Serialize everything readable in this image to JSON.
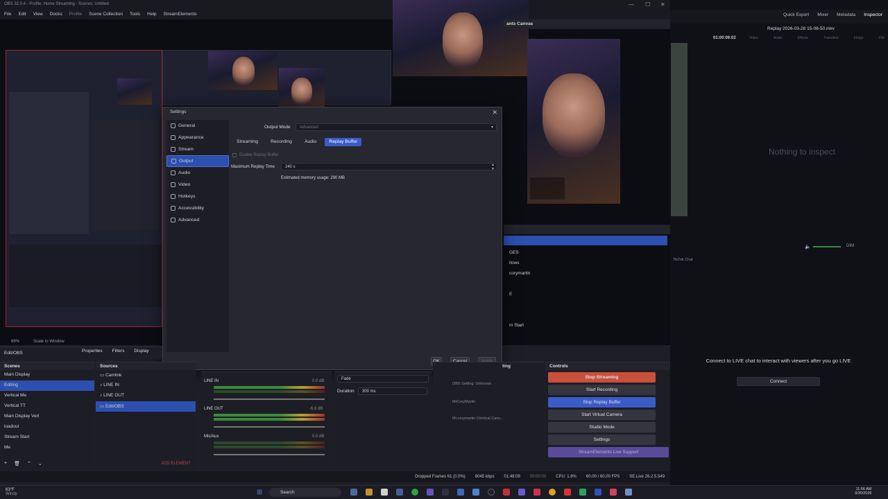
{
  "window": {
    "title": "OBS 32.0.4 - Profile: Home Streaming - Scenes: Untitled",
    "menu": [
      "File",
      "Edit",
      "View",
      "Docks",
      "Profile",
      "Scene Collection",
      "Tools",
      "Help",
      "StreamElements"
    ]
  },
  "preview": {
    "zoom_label": "69%",
    "scale_label": "Scale to Window",
    "canvas_label": "ants Canvas",
    "sources_list": [
      "GES",
      "llows",
      "corymartin",
      "E",
      "m Start"
    ]
  },
  "right_panel": {
    "toolbar": [
      "Quick Export",
      "Mixer",
      "Metadata",
      "Inspector"
    ],
    "file_name": "Replay 2026-03-28 15-08-50.mkv",
    "timecode": "01:00:06:02",
    "inspector_tabs": [
      "Video",
      "Audio",
      "Effects",
      "Transition",
      "Image",
      "File"
    ],
    "empty_text": "Nothing to inspect",
    "volume_label": "DIM",
    "chat_title": "TikTok Chat",
    "chat_message": "Connect to LIVE chat to interact with viewers after you go LIVE",
    "connect_label": "Connect"
  },
  "settings": {
    "title": "Settings",
    "sidebar": [
      {
        "label": "General",
        "icon": "gear-icon"
      },
      {
        "label": "Appearance",
        "icon": "palette-icon"
      },
      {
        "label": "Stream",
        "icon": "stream-icon"
      },
      {
        "label": "Output",
        "icon": "output-icon"
      },
      {
        "label": "Audio",
        "icon": "speaker-icon"
      },
      {
        "label": "Video",
        "icon": "monitor-icon"
      },
      {
        "label": "Hotkeys",
        "icon": "keyboard-icon"
      },
      {
        "label": "Accessibility",
        "icon": "accessibility-icon"
      },
      {
        "label": "Advanced",
        "icon": "wrench-icon"
      }
    ],
    "output_mode_label": "Output Mode",
    "output_mode_value": "Advanced",
    "tabs": [
      "Streaming",
      "Recording",
      "Audio",
      "Replay Buffer"
    ],
    "enable_replay_label": "Enable Replay Buffer",
    "max_replay_label": "Maximum Replay Time",
    "max_replay_value": "240 s",
    "memory_usage": "Estimated memory usage: 290 MB",
    "ok": "OK",
    "cancel": "Cancel",
    "apply": "Apply"
  },
  "docks": {
    "editobs_label": "Edit/OBS",
    "properties": "Properties",
    "filters": "Filters",
    "display": "Display",
    "scenes_title": "Scenes",
    "scenes": [
      "Main Display",
      "Editing",
      "Vertical Me",
      "Vertical TT",
      "Main Display Vert",
      "loadout",
      "Stream Start",
      "Me"
    ],
    "sources_title": "Sources",
    "sources": [
      "Camlink",
      "LINE IN",
      "LINE OUT",
      "Edit/OBS"
    ],
    "add_element": "ADD ELEMENT",
    "mixer": [
      {
        "name": "LINE IN",
        "db": "0.0 dB"
      },
      {
        "name": "LINE OUT",
        "db": "-6.6 dB"
      },
      {
        "name": "Mic/Aux",
        "db": "0.0 dB"
      }
    ],
    "transition": "Fade",
    "duration_label": "Duration",
    "duration_value": "300 ms",
    "ting_label": "ting",
    "ting_items": [
      "OBS Setting: Unknown",
      "MrCoryMartin",
      "Mr.corymartin (Vertical Canv..."
    ],
    "controls_title": "Controls",
    "controls": {
      "stop_streaming": "Stop Streaming",
      "start_recording": "Start Recording",
      "stop_replay": "Stop Replay Buffer",
      "start_virtual_cam": "Start Virtual Camera",
      "studio_mode": "Studio Mode",
      "settings": "Settings",
      "live_support": "StreamElements Live Support"
    }
  },
  "status": {
    "dropped": "Dropped Frames 61 (0.0%)",
    "bitrate": "8045 kbps",
    "live_time": "01:48:09",
    "rec_time": "00:00:00",
    "cpu": "CPU: 1.6%",
    "fps": "60.00 / 60.00 FPS",
    "se_live": "SE.Live 26.2.5.549"
  },
  "taskbar": {
    "weather_temp": "63°F",
    "weather_desc": "Windy",
    "search": "Search",
    "time": "11:56 AM",
    "date": "3/30/2026"
  },
  "colors": {
    "accent": "#2c4fb0",
    "stop_stream": "#c9503a",
    "stop_replay": "#3b5bc8"
  }
}
